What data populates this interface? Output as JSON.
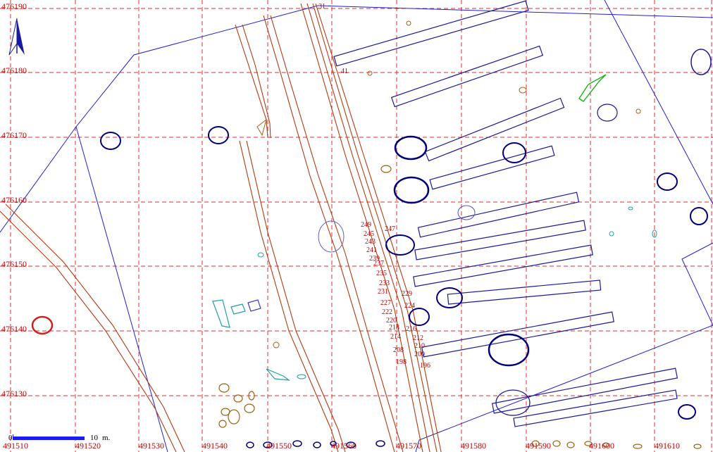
{
  "grid": {
    "color": "#e03030",
    "y_labels": [
      "476190",
      "476180",
      "476170",
      "476160",
      "476150",
      "476140",
      "476130"
    ],
    "x_labels": [
      "491510",
      "491520",
      "491530",
      "491540",
      "491550",
      "491560",
      "491570",
      "491580",
      "491590",
      "491600",
      "491610"
    ]
  },
  "north_arrow": {
    "icon": "north-arrow-icon",
    "color": "#1a1aa0"
  },
  "scale_bar": {
    "start_label": "0",
    "end_label": "10",
    "unit_label": "m.",
    "color": "#1a1aff"
  },
  "feature_labels": [
    "31",
    "41",
    "249",
    "245",
    "243",
    "241",
    "239",
    "247",
    "237",
    "235",
    "233",
    "231",
    "229",
    "227",
    "224",
    "222",
    "220",
    "218",
    "216",
    "214",
    "212",
    "210",
    "208",
    "200",
    "198",
    "196"
  ],
  "colors": {
    "trench": "#1a1a9a",
    "pit_dark": "#00007a",
    "ditch": "#b03a10",
    "boundary": "#2020d0",
    "cyan": "#20a0a0",
    "green": "#20b020",
    "brown": "#a06010",
    "red_feature": "#d02020"
  }
}
